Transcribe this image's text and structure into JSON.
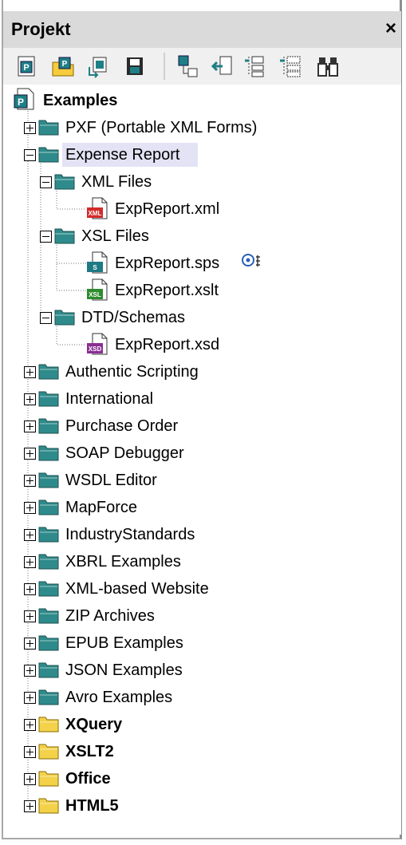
{
  "panel": {
    "title": "Projekt",
    "close_glyph": "×"
  },
  "toolbar": {
    "buttons": [
      {
        "name": "new-project-icon"
      },
      {
        "name": "open-project-icon"
      },
      {
        "name": "reload-project-icon"
      },
      {
        "name": "save-project-icon"
      },
      {
        "name": "add-files-icon"
      },
      {
        "name": "add-active-file-icon"
      },
      {
        "name": "add-folder-icon"
      },
      {
        "name": "add-external-folder-icon"
      },
      {
        "name": "find-in-project-icon"
      }
    ]
  },
  "tree": {
    "root": "Examples",
    "items": [
      "PXF (Portable XML Forms)",
      "Expense Report",
      "XML Files",
      "ExpReport.xml",
      "XSL Files",
      "ExpReport.sps",
      "ExpReport.xslt",
      "DTD/Schemas",
      "ExpReport.xsd",
      "Authentic Scripting",
      "International",
      "Purchase Order",
      "SOAP Debugger",
      "WSDL Editor",
      "MapForce",
      "IndustryStandards",
      "XBRL Examples",
      "XML-based Website",
      "ZIP Archives",
      "EPUB Examples",
      "JSON Examples",
      "Avro Examples",
      "XQuery",
      "XSLT2",
      "Office",
      "HTML5"
    ]
  },
  "colors": {
    "folder_teal": "#2f8b8b",
    "folder_yellow": "#f3d24a",
    "selection": "#e3e3f5",
    "xml_badge": "#d22b2b",
    "sps_badge": "#1e7a84",
    "xslt_badge": "#2e8b2e",
    "xsd_badge": "#8a2e92"
  }
}
